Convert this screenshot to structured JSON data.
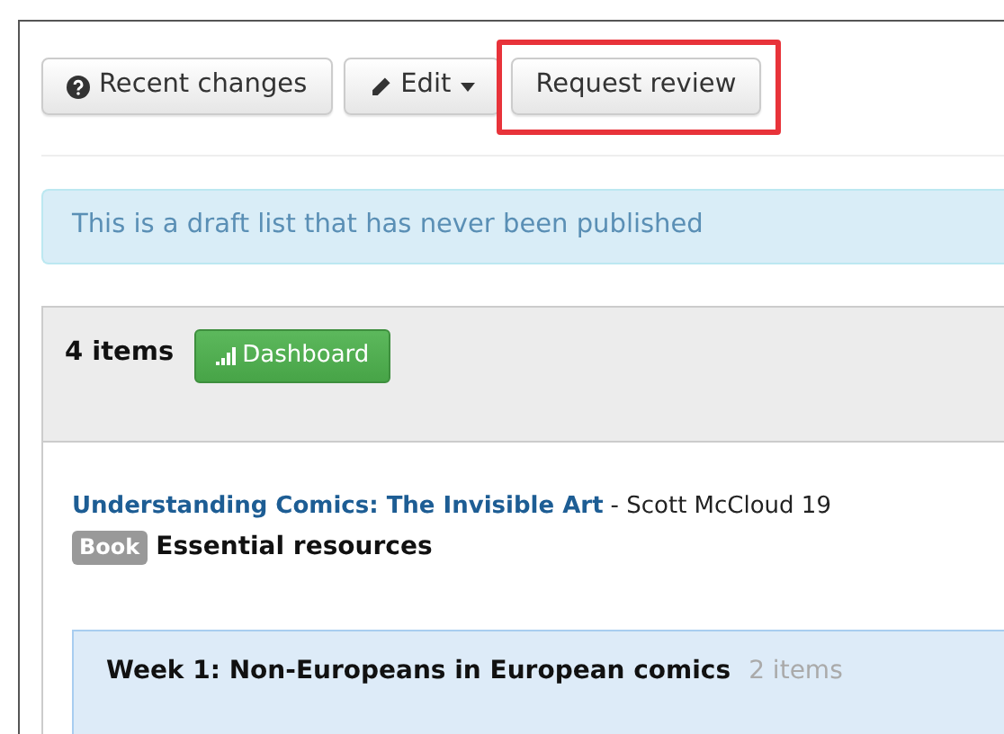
{
  "toolbar": {
    "buttons": [
      {
        "kind": "help",
        "label": "Recent changes",
        "highlighted": false
      },
      {
        "kind": "dropdown",
        "label": "Edit",
        "highlighted": false
      },
      {
        "kind": "plain",
        "label": "Request review",
        "highlighted": true
      }
    ]
  },
  "alert": {
    "text": "This is a draft list that has never been published"
  },
  "list": {
    "count": "4 items",
    "dashboard_button": "Dashboard",
    "items": [
      {
        "title": "Understanding Comics: The Invisible Art",
        "byline": "- Scott McCloud 19",
        "type_badge": "Book",
        "importance": "Essential resources"
      }
    ],
    "section": {
      "title": "Week 1: Non-Europeans in European comics",
      "count": "2 items"
    }
  }
}
